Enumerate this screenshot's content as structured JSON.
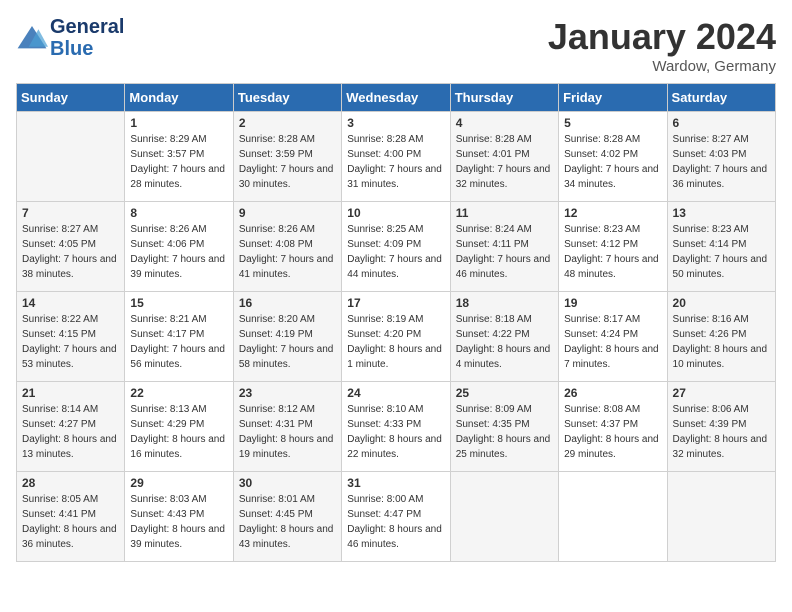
{
  "header": {
    "logo_line1": "General",
    "logo_line2": "Blue",
    "month": "January 2024",
    "location": "Wardow, Germany"
  },
  "weekdays": [
    "Sunday",
    "Monday",
    "Tuesday",
    "Wednesday",
    "Thursday",
    "Friday",
    "Saturday"
  ],
  "weeks": [
    [
      {
        "day": "",
        "sunrise": "",
        "sunset": "",
        "daylight": ""
      },
      {
        "day": "1",
        "sunrise": "Sunrise: 8:29 AM",
        "sunset": "Sunset: 3:57 PM",
        "daylight": "Daylight: 7 hours and 28 minutes."
      },
      {
        "day": "2",
        "sunrise": "Sunrise: 8:28 AM",
        "sunset": "Sunset: 3:59 PM",
        "daylight": "Daylight: 7 hours and 30 minutes."
      },
      {
        "day": "3",
        "sunrise": "Sunrise: 8:28 AM",
        "sunset": "Sunset: 4:00 PM",
        "daylight": "Daylight: 7 hours and 31 minutes."
      },
      {
        "day": "4",
        "sunrise": "Sunrise: 8:28 AM",
        "sunset": "Sunset: 4:01 PM",
        "daylight": "Daylight: 7 hours and 32 minutes."
      },
      {
        "day": "5",
        "sunrise": "Sunrise: 8:28 AM",
        "sunset": "Sunset: 4:02 PM",
        "daylight": "Daylight: 7 hours and 34 minutes."
      },
      {
        "day": "6",
        "sunrise": "Sunrise: 8:27 AM",
        "sunset": "Sunset: 4:03 PM",
        "daylight": "Daylight: 7 hours and 36 minutes."
      }
    ],
    [
      {
        "day": "7",
        "sunrise": "Sunrise: 8:27 AM",
        "sunset": "Sunset: 4:05 PM",
        "daylight": "Daylight: 7 hours and 38 minutes."
      },
      {
        "day": "8",
        "sunrise": "Sunrise: 8:26 AM",
        "sunset": "Sunset: 4:06 PM",
        "daylight": "Daylight: 7 hours and 39 minutes."
      },
      {
        "day": "9",
        "sunrise": "Sunrise: 8:26 AM",
        "sunset": "Sunset: 4:08 PM",
        "daylight": "Daylight: 7 hours and 41 minutes."
      },
      {
        "day": "10",
        "sunrise": "Sunrise: 8:25 AM",
        "sunset": "Sunset: 4:09 PM",
        "daylight": "Daylight: 7 hours and 44 minutes."
      },
      {
        "day": "11",
        "sunrise": "Sunrise: 8:24 AM",
        "sunset": "Sunset: 4:11 PM",
        "daylight": "Daylight: 7 hours and 46 minutes."
      },
      {
        "day": "12",
        "sunrise": "Sunrise: 8:23 AM",
        "sunset": "Sunset: 4:12 PM",
        "daylight": "Daylight: 7 hours and 48 minutes."
      },
      {
        "day": "13",
        "sunrise": "Sunrise: 8:23 AM",
        "sunset": "Sunset: 4:14 PM",
        "daylight": "Daylight: 7 hours and 50 minutes."
      }
    ],
    [
      {
        "day": "14",
        "sunrise": "Sunrise: 8:22 AM",
        "sunset": "Sunset: 4:15 PM",
        "daylight": "Daylight: 7 hours and 53 minutes."
      },
      {
        "day": "15",
        "sunrise": "Sunrise: 8:21 AM",
        "sunset": "Sunset: 4:17 PM",
        "daylight": "Daylight: 7 hours and 56 minutes."
      },
      {
        "day": "16",
        "sunrise": "Sunrise: 8:20 AM",
        "sunset": "Sunset: 4:19 PM",
        "daylight": "Daylight: 7 hours and 58 minutes."
      },
      {
        "day": "17",
        "sunrise": "Sunrise: 8:19 AM",
        "sunset": "Sunset: 4:20 PM",
        "daylight": "Daylight: 8 hours and 1 minute."
      },
      {
        "day": "18",
        "sunrise": "Sunrise: 8:18 AM",
        "sunset": "Sunset: 4:22 PM",
        "daylight": "Daylight: 8 hours and 4 minutes."
      },
      {
        "day": "19",
        "sunrise": "Sunrise: 8:17 AM",
        "sunset": "Sunset: 4:24 PM",
        "daylight": "Daylight: 8 hours and 7 minutes."
      },
      {
        "day": "20",
        "sunrise": "Sunrise: 8:16 AM",
        "sunset": "Sunset: 4:26 PM",
        "daylight": "Daylight: 8 hours and 10 minutes."
      }
    ],
    [
      {
        "day": "21",
        "sunrise": "Sunrise: 8:14 AM",
        "sunset": "Sunset: 4:27 PM",
        "daylight": "Daylight: 8 hours and 13 minutes."
      },
      {
        "day": "22",
        "sunrise": "Sunrise: 8:13 AM",
        "sunset": "Sunset: 4:29 PM",
        "daylight": "Daylight: 8 hours and 16 minutes."
      },
      {
        "day": "23",
        "sunrise": "Sunrise: 8:12 AM",
        "sunset": "Sunset: 4:31 PM",
        "daylight": "Daylight: 8 hours and 19 minutes."
      },
      {
        "day": "24",
        "sunrise": "Sunrise: 8:10 AM",
        "sunset": "Sunset: 4:33 PM",
        "daylight": "Daylight: 8 hours and 22 minutes."
      },
      {
        "day": "25",
        "sunrise": "Sunrise: 8:09 AM",
        "sunset": "Sunset: 4:35 PM",
        "daylight": "Daylight: 8 hours and 25 minutes."
      },
      {
        "day": "26",
        "sunrise": "Sunrise: 8:08 AM",
        "sunset": "Sunset: 4:37 PM",
        "daylight": "Daylight: 8 hours and 29 minutes."
      },
      {
        "day": "27",
        "sunrise": "Sunrise: 8:06 AM",
        "sunset": "Sunset: 4:39 PM",
        "daylight": "Daylight: 8 hours and 32 minutes."
      }
    ],
    [
      {
        "day": "28",
        "sunrise": "Sunrise: 8:05 AM",
        "sunset": "Sunset: 4:41 PM",
        "daylight": "Daylight: 8 hours and 36 minutes."
      },
      {
        "day": "29",
        "sunrise": "Sunrise: 8:03 AM",
        "sunset": "Sunset: 4:43 PM",
        "daylight": "Daylight: 8 hours and 39 minutes."
      },
      {
        "day": "30",
        "sunrise": "Sunrise: 8:01 AM",
        "sunset": "Sunset: 4:45 PM",
        "daylight": "Daylight: 8 hours and 43 minutes."
      },
      {
        "day": "31",
        "sunrise": "Sunrise: 8:00 AM",
        "sunset": "Sunset: 4:47 PM",
        "daylight": "Daylight: 8 hours and 46 minutes."
      },
      {
        "day": "",
        "sunrise": "",
        "sunset": "",
        "daylight": ""
      },
      {
        "day": "",
        "sunrise": "",
        "sunset": "",
        "daylight": ""
      },
      {
        "day": "",
        "sunrise": "",
        "sunset": "",
        "daylight": ""
      }
    ]
  ]
}
